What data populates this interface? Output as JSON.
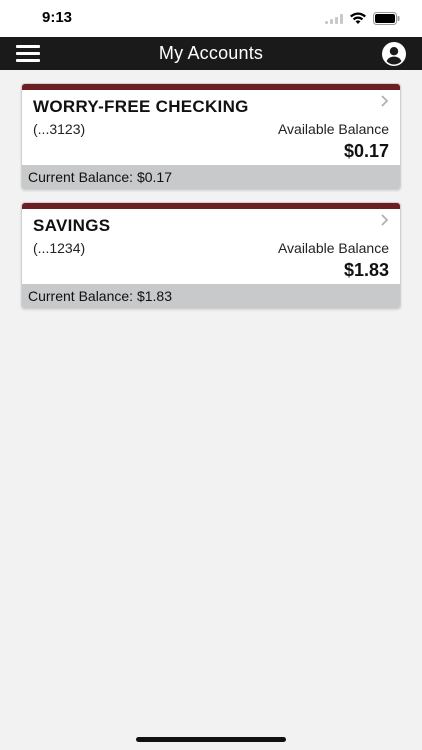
{
  "status_bar": {
    "time": "9:13",
    "icons": [
      "signal-icon",
      "wifi-icon",
      "battery-icon"
    ]
  },
  "nav": {
    "title": "My Accounts",
    "left_icon": "hamburger-menu-icon",
    "right_icon": "profile-icon"
  },
  "accounts": [
    {
      "name": "WORRY-FREE CHECKING",
      "number": "(...3123)",
      "available_label": "Available Balance",
      "available_balance": "$0.17",
      "current_label": "Current Balance: $0.17"
    },
    {
      "name": "SAVINGS",
      "number": "(...1234)",
      "available_label": "Available Balance",
      "available_balance": "$1.83",
      "current_label": "Current Balance: $1.83"
    }
  ],
  "colors": {
    "nav_background": "#1a1a1a",
    "card_accent": "#6b1f22",
    "card_footer": "#c7c9ca",
    "page_background": "#f2f2f2"
  }
}
